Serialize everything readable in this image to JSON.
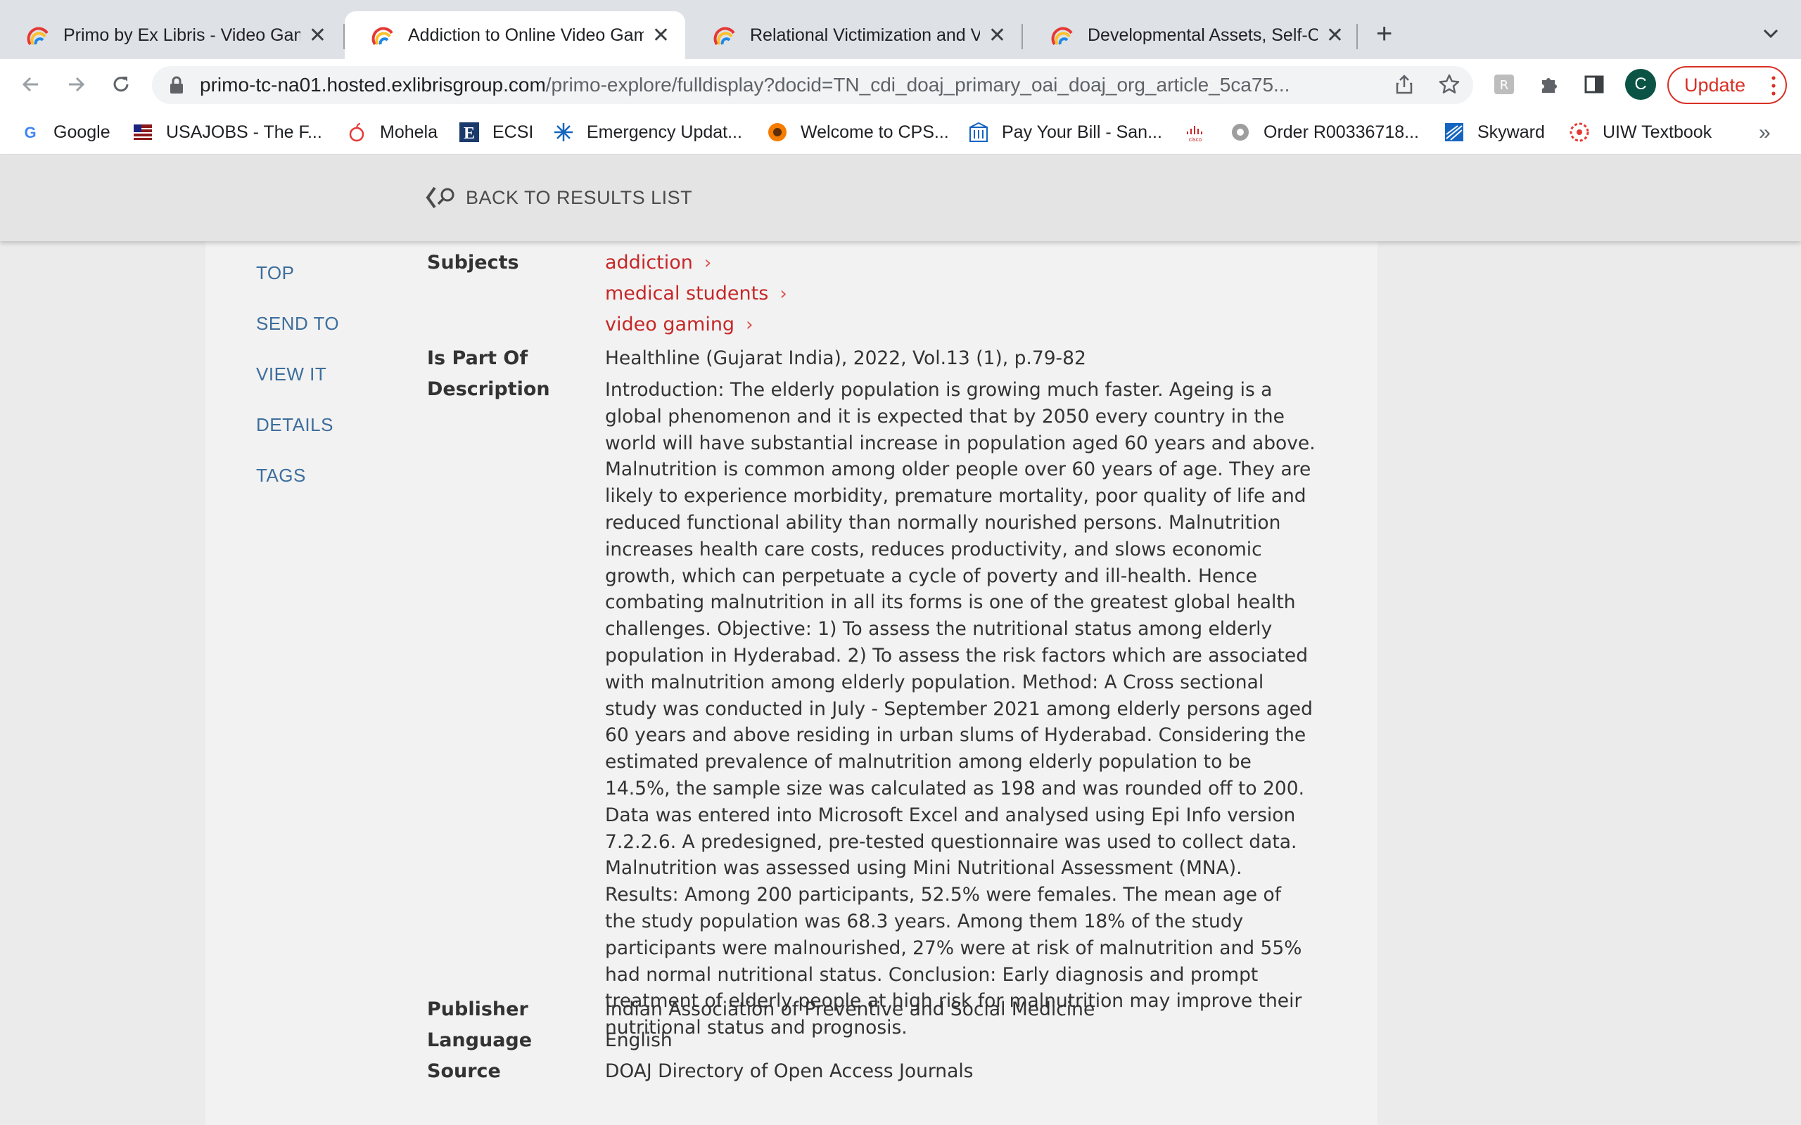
{
  "browser": {
    "tabs": [
      {
        "title": "Primo by Ex Libris - Video Gaming",
        "close": "✕"
      },
      {
        "title": "Addiction to Online Video Gaming",
        "close": "✕"
      },
      {
        "title": "Relational Victimization and Video",
        "close": "✕"
      },
      {
        "title": "Developmental Assets, Self-Control",
        "close": "✕"
      }
    ],
    "new_tab": "+",
    "url_host": "primo-tc-na01.hosted.exlibrisgroup.com",
    "url_path": "/primo-explore/fulldisplay?docid=TN_cdi_doaj_primary_oai_doaj_org_article_5ca75...",
    "avatar_letter": "C",
    "update_label": "Update",
    "bookmarks": [
      "Google",
      "USAJOBS - The F...",
      "Mohela",
      "ECSI",
      "Emergency Updat...",
      "Welcome to CPS...",
      "Pay Your Bill - San...",
      "Order R00336718...",
      "Skyward",
      "UIW Textbook"
    ],
    "bookmarks_more": "»"
  },
  "header": {
    "back_label": "BACK TO RESULTS LIST"
  },
  "sidenav": [
    "TOP",
    "SEND TO",
    "VIEW IT",
    "DETAILS",
    "TAGS"
  ],
  "record": {
    "subjects_label": "Subjects",
    "subjects": [
      "addiction",
      "medical students",
      "video gaming"
    ],
    "is_part_of_label": "Is Part Of",
    "is_part_of": "Healthline (Gujarat India), 2022, Vol.13 (1), p.79-82",
    "description_label": "Description",
    "description": "Introduction: The elderly population is growing much faster. Ageing is a global phenomenon and it is expected that by 2050 every country in the world will have substantial increase in population aged 60 years and above. Malnutrition is common among older people over 60 years of age. They are likely to experience morbidity, premature mortality, poor quality of life and reduced functional ability than normally nourished persons. Malnutrition increases health care costs, reduces productivity, and slows economic growth, which can perpetuate a cycle of poverty and ill-health. Hence combating malnutrition in all its forms is one of the greatest global health challenges. Objective: 1) To assess the nutritional status among elderly population in Hyderabad. 2) To assess the risk factors which are associated with malnutrition among elderly population. Method: A Cross sectional study was conducted in July - September 2021 among elderly persons aged 60 years and above residing in urban slums of Hyderabad. Considering the estimated prevalence of malnutrition among elderly population to be 14.5%, the sample size was calculated as 198 and was rounded off to 200. Data was entered into Microsoft Excel and analysed using Epi Info version 7.2.2.6. A predesigned, pre-tested questionnaire was used to collect data. Malnutrition was assessed using Mini Nutritional Assessment (MNA). Results: Among 200 participants, 52.5% were females. The mean age of the study population was 68.3 years. Among them 18% of the study participants were malnourished, 27% were at risk of malnutrition and 55% had normal nutritional status. Conclusion: Early diagnosis and prompt treatment of elderly people at high risk for malnutrition may improve their nutritional status and prognosis.",
    "publisher_label": "Publisher",
    "publisher": "Indian Association of Preventive and Social Medicine",
    "language_label": "Language",
    "language": "English",
    "source_label": "Source",
    "source": "DOAJ Directory of Open Access Journals"
  }
}
